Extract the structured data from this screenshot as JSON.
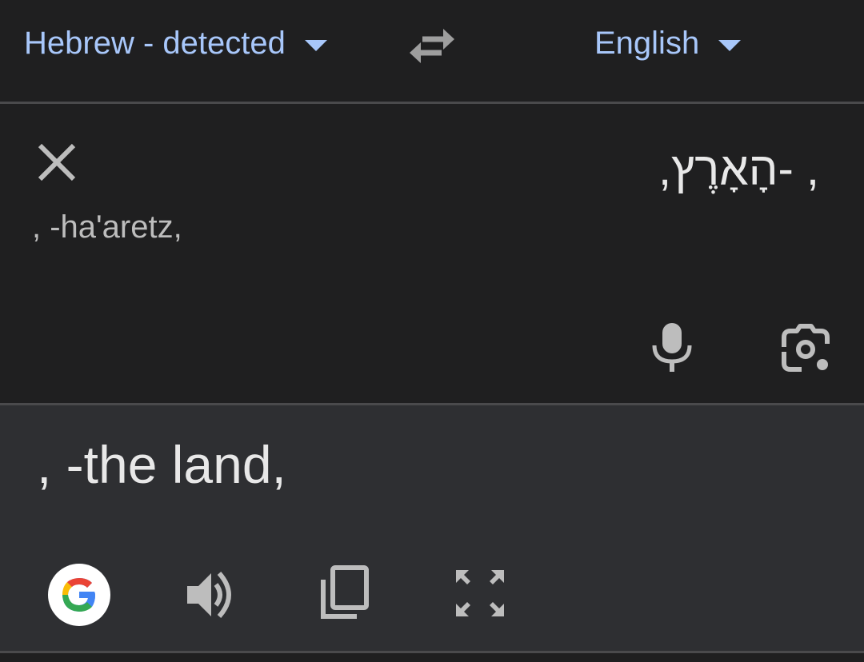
{
  "language_bar": {
    "source_language": "Hebrew - detected",
    "target_language": "English",
    "dropdown_icon": "caret-down-icon",
    "swap_icon": "swap-arrows-icon"
  },
  "source": {
    "text": ", -הָאָרֶץ,",
    "transliteration": ", -ha'aretz,",
    "clear_icon": "close-icon",
    "mic_icon": "microphone-icon",
    "camera_icon": "camera-lens-icon"
  },
  "result": {
    "text": ", -the land,",
    "google_icon": "google-g-icon",
    "speaker_icon": "speaker-icon",
    "copy_icon": "copy-icon",
    "fullscreen_icon": "fullscreen-icon"
  },
  "colors": {
    "background": "#1f1f20",
    "result_background": "#2e2f32",
    "accent_link": "#a8c7fa",
    "icon_gray": "#bdbdbd",
    "text_primary": "#e8e8e8",
    "divider": "#4a4a4c"
  }
}
